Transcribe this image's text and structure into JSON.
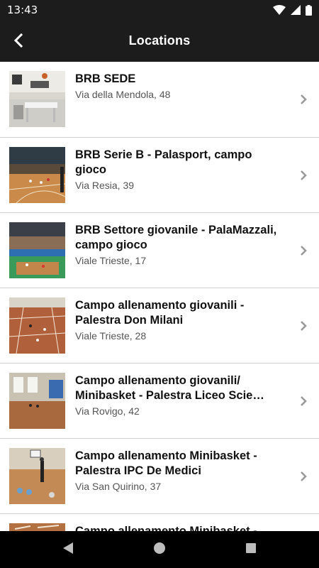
{
  "status_bar": {
    "time": "13:43",
    "icons": [
      "wifi-icon",
      "signal-icon",
      "battery-icon"
    ]
  },
  "app_bar": {
    "title": "Locations",
    "back_icon": "back-arrow-icon"
  },
  "locations": [
    {
      "title": "BRB SEDE",
      "address": "Via della Mendola, 48",
      "thumb": "office-photo"
    },
    {
      "title": "BRB Serie B - Palasport, campo gioco",
      "address": "Via Resia, 39",
      "thumb": "arena-photo"
    },
    {
      "title": "BRB Settore giovanile - PalaMazzali, campo gioco",
      "address": "Viale Trieste, 17",
      "thumb": "arena-crowd-photo"
    },
    {
      "title": "Campo allenamento giovanili - Palestra Don Milani",
      "address": "Viale Trieste, 28",
      "thumb": "gym-court-photo"
    },
    {
      "title": "Campo allenamento giovanili/ Minibasket - Palestra Liceo Scie…",
      "address": "Via Rovigo, 42",
      "thumb": "gym-windows-photo"
    },
    {
      "title": "Campo allenamento Minibasket - Palestra IPC De Medici",
      "address": "Via San Quirino, 37",
      "thumb": "kids-practice-photo"
    },
    {
      "title": "Campo allenamento Minibasket -",
      "address": "",
      "thumb": "court-photo"
    }
  ],
  "colors": {
    "bar_background": "#1c1c1c",
    "nav_background": "#000000",
    "title_text": "#111111",
    "subtitle_text": "#555555",
    "chevron": "#9a9a9a",
    "divider": "#cfcfcf"
  },
  "nav_bar": {
    "buttons": [
      "back-triangle-icon",
      "home-circle-icon",
      "recents-square-icon"
    ]
  }
}
